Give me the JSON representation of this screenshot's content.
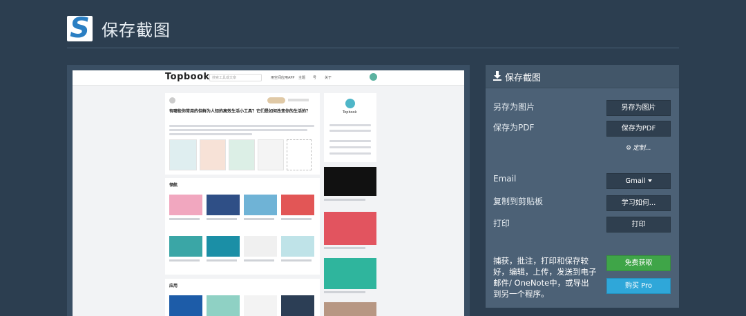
{
  "app": {
    "title": "保存截图",
    "logo_icon": "s-logo-icon"
  },
  "preview": {
    "site_logo": "Topbook",
    "search_placeholder": "搜索工具或文章",
    "nav": [
      "用空间应用APP",
      "主题",
      "号",
      "关于"
    ],
    "article_title": "有哪些你常用的但鲜为人知的高效生活小工具？它们是如何改变你的生活的？",
    "section_1": "领航",
    "section_2": "应用",
    "profile_name": "Topbook"
  },
  "panel": {
    "title": "保存截图",
    "save_image_label": "另存为图片",
    "save_image_button": "另存为图片",
    "save_pdf_label": "保存为PDF",
    "save_pdf_button": "保存为PDF",
    "customize": "定制...",
    "email_label": "Email",
    "email_button": "Gmail",
    "clipboard_label": "复制到剪贴板",
    "clipboard_button": "学习如何...",
    "print_label": "打印",
    "print_button": "打印",
    "promo_text": "捕获，批注，打印和保存较好，编辑，上传，发送到电子邮件/ OneNote中，或导出到另一个程序。",
    "free_button": "免费获取",
    "pro_button": "购买 Pro"
  },
  "colors": {
    "background": "#2c3e50",
    "panel": "#4c6176",
    "button": "#2f3f4f",
    "green": "#3fa548",
    "blue": "#2fa7d9"
  }
}
